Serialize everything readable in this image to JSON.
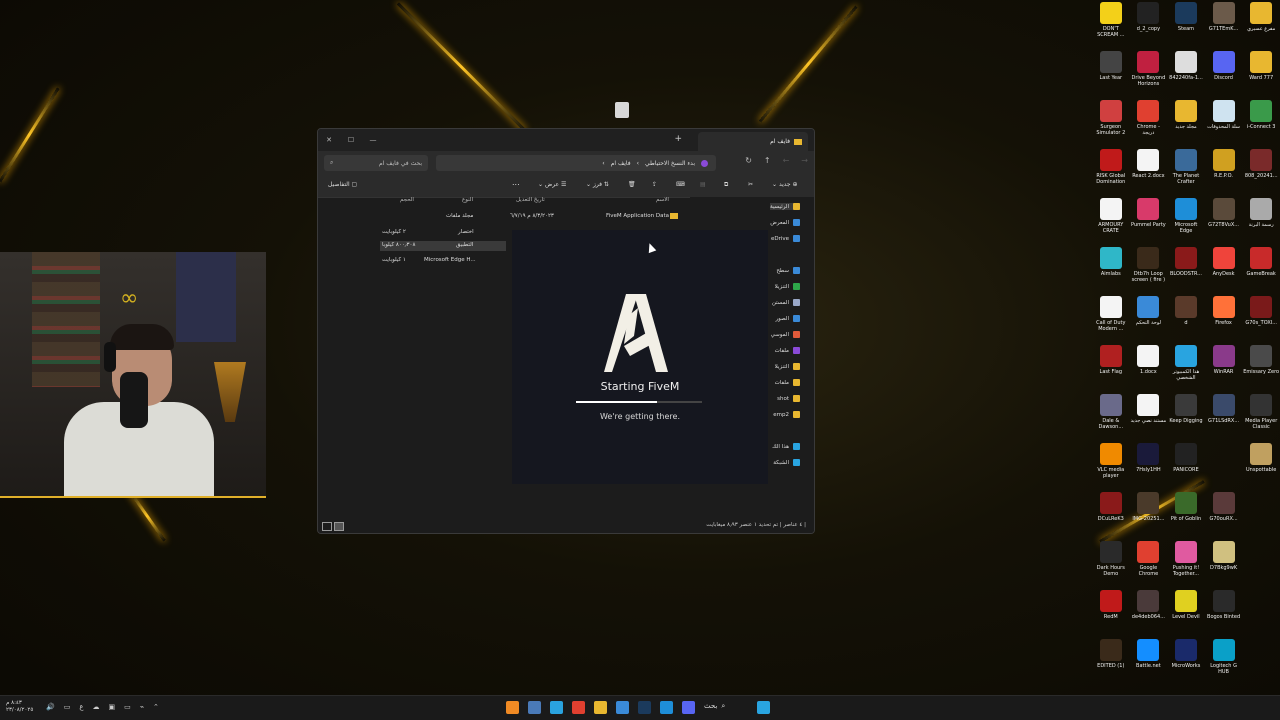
{
  "desktop_icons": [
    {
      "label": "DON'T SCREAM ...",
      "icon": "dont-scream-icon",
      "color": "#f3d019"
    },
    {
      "label": "d_2_copy",
      "icon": "file-icon",
      "color": "#222222"
    },
    {
      "label": "Steam",
      "icon": "steam-icon",
      "color": "#1b3a5c"
    },
    {
      "label": "G71TEmK...",
      "icon": "image-icon",
      "color": "#6b5a4a"
    },
    {
      "label": "مفرغ عسيري",
      "icon": "folder-icon",
      "color": "#e8b730"
    },
    {
      "label": "Last Year",
      "icon": "last-year-icon",
      "color": "#444444"
    },
    {
      "label": "Drive Beyond Horizons",
      "icon": "game-icon",
      "color": "#c02040"
    },
    {
      "label": "842240fa-1...",
      "icon": "qr-icon",
      "color": "#dddddd"
    },
    {
      "label": "Discord",
      "icon": "discord-icon",
      "color": "#5865f2"
    },
    {
      "label": "Ward 777",
      "icon": "folder-icon",
      "color": "#e8b730"
    },
    {
      "label": "Surgeon Simulator 2",
      "icon": "game-icon",
      "color": "#d04040"
    },
    {
      "label": "Chrome - دريجة",
      "icon": "chrome-icon",
      "color": "#e04030"
    },
    {
      "label": "مجلد جديد",
      "icon": "folder-icon",
      "color": "#e8b730"
    },
    {
      "label": "سلة المحذوفات",
      "icon": "recycle-bin-icon",
      "color": "#cfe3f0"
    },
    {
      "label": "i-Connect 3",
      "icon": "app-icon",
      "color": "#3a9a4a"
    },
    {
      "label": "RISK Global Domination",
      "icon": "risk-icon",
      "color": "#c01a1a"
    },
    {
      "label": "React 2.docx",
      "icon": "document-icon",
      "color": "#f4f4f4"
    },
    {
      "label": "The Planet Crafter",
      "icon": "game-icon",
      "color": "#3a6a9a"
    },
    {
      "label": "R.E.P.O.",
      "icon": "game-icon",
      "color": "#d0a020"
    },
    {
      "label": "808_20241...",
      "icon": "image-icon",
      "color": "#7a2a2a"
    },
    {
      "label": "ARMOURY CRATE",
      "icon": "document-icon",
      "color": "#f4f4f4"
    },
    {
      "label": "Pummel Party",
      "icon": "game-icon",
      "color": "#d83a6a"
    },
    {
      "label": "Microsoft Edge",
      "icon": "edge-icon",
      "color": "#1e8ed8"
    },
    {
      "label": "G72T8VuX...",
      "icon": "image-icon",
      "color": "#5a4a3a"
    },
    {
      "label": "رسمة البرنة",
      "icon": "image-icon",
      "color": "#aaaaaa"
    },
    {
      "label": "Aimlabs",
      "icon": "aimlabs-icon",
      "color": "#2fb7c8"
    },
    {
      "label": "Dtb7h Loop screen ( fire )",
      "icon": "video-icon",
      "color": "#3a2a1a"
    },
    {
      "label": "BLOODSTR...",
      "icon": "game-icon",
      "color": "#8a1a1a"
    },
    {
      "label": "AnyDesk",
      "icon": "anydesk-icon",
      "color": "#ef443b"
    },
    {
      "label": "GameBreak",
      "icon": "game-icon",
      "color": "#c82a2a"
    },
    {
      "label": "Call of Duty Modern ...",
      "icon": "document-icon",
      "color": "#f4f4f4"
    },
    {
      "label": "لوحة التحكم",
      "icon": "control-panel-icon",
      "color": "#3a8ad8"
    },
    {
      "label": "d",
      "icon": "file-icon",
      "color": "#5a3a2a"
    },
    {
      "label": "Firefox",
      "icon": "firefox-icon",
      "color": "#ff7139"
    },
    {
      "label": "G70s_TOXI...",
      "icon": "image-icon",
      "color": "#7a1a1a"
    },
    {
      "label": "Last Flag",
      "icon": "game-icon",
      "color": "#b02020"
    },
    {
      "label": "1.docx",
      "icon": "document-icon",
      "color": "#f4f4f4"
    },
    {
      "label": "هذا الكمبيوتر الشخصي",
      "icon": "computer-icon",
      "color": "#29a4e0"
    },
    {
      "label": "WinRAR",
      "icon": "winrar-icon",
      "color": "#8a3a8a"
    },
    {
      "label": "Emissary Zero",
      "icon": "game-icon",
      "color": "#4a4a4a"
    },
    {
      "label": "Dale & Dawson...",
      "icon": "game-icon",
      "color": "#6a6a8a"
    },
    {
      "label": "مستند نصي جديد",
      "icon": "document-icon",
      "color": "#f4f4f4"
    },
    {
      "label": "Keep Digging",
      "icon": "game-icon",
      "color": "#3a3a3a"
    },
    {
      "label": "G71LSdRX...",
      "icon": "image-icon",
      "color": "#3a4a6a"
    },
    {
      "label": "Media Player Classic",
      "icon": "media-player-icon",
      "color": "#333333"
    },
    {
      "label": "VLC media player",
      "icon": "vlc-icon",
      "color": "#f08a00"
    },
    {
      "label": "7Hsly1HH",
      "icon": "image-icon",
      "color": "#1a1a3a"
    },
    {
      "label": "PANICORE",
      "icon": "game-icon",
      "color": "#222222"
    },
    {
      "label": "",
      "icon": "blank-icon",
      "color": "#000000"
    },
    {
      "label": "Unspottable",
      "icon": "game-icon",
      "color": "#c0a060"
    },
    {
      "label": "DCuLReK3",
      "icon": "image-icon",
      "color": "#8a1a1a"
    },
    {
      "label": "IMG-20251...",
      "icon": "image-icon",
      "color": "#4a3a2a"
    },
    {
      "label": "Pit of Goblin",
      "icon": "game-icon",
      "color": "#3a6a2a"
    },
    {
      "label": "G70ouRX...",
      "icon": "image-icon",
      "color": "#5a3a3a"
    },
    {
      "label": "",
      "icon": "blank-icon",
      "color": "#000000"
    },
    {
      "label": "Dark Hours Demo",
      "icon": "game-icon",
      "color": "#2a2a2a"
    },
    {
      "label": "Google Chrome",
      "icon": "chrome-icon",
      "color": "#e04030"
    },
    {
      "label": "Pushing it! Together...",
      "icon": "game-icon",
      "color": "#e05aa0"
    },
    {
      "label": "D7Bkg9wK",
      "icon": "image-icon",
      "color": "#d0c080"
    },
    {
      "label": "",
      "icon": "blank-icon",
      "color": "#000000"
    },
    {
      "label": "RedM",
      "icon": "redm-icon",
      "color": "#c01a1a"
    },
    {
      "label": "de4deb064...",
      "icon": "image-icon",
      "color": "#4a3a3a"
    },
    {
      "label": "Level Devil",
      "icon": "game-icon",
      "color": "#e0d020"
    },
    {
      "label": "Bogos Binted",
      "icon": "game-icon",
      "color": "#2a2a2a"
    },
    {
      "label": "",
      "icon": "blank-icon",
      "color": "#000000"
    },
    {
      "label": "EDITED (1)",
      "icon": "image-icon",
      "color": "#3a2a1a"
    },
    {
      "label": "Battle.net",
      "icon": "battlenet-icon",
      "color": "#148eff"
    },
    {
      "label": "MicroWorks",
      "icon": "microworks-icon",
      "color": "#1a2a6a"
    },
    {
      "label": "Logitech G HUB",
      "icon": "logitech-icon",
      "color": "#0aa0c8"
    }
  ],
  "explorer": {
    "tab_title": "فايف ام",
    "search_placeholder": "بحث في فايف ام",
    "breadcrumb": [
      "بدء النسخ الاحتياطي",
      "فايف ام"
    ],
    "toolbar": {
      "new": "جديد",
      "sort": "فرز",
      "view": "عرض",
      "more": "...",
      "details": "التفاصيل"
    },
    "columns": {
      "name": "الاسم",
      "date": "تاريخ التعديل",
      "type": "النوع",
      "size": "الحجم"
    },
    "rows": [
      {
        "name": "FiveM Application Data",
        "date": "٨/٣/٢٠٢٣ م ٦/٧/١٩",
        "type": "مجلد ملفات",
        "size": ""
      },
      {
        "name": "",
        "date": "",
        "type": "اختصار",
        "size": "٢ كيلوبايت"
      },
      {
        "name": "",
        "date": "",
        "type": "التطبيق",
        "size": "٨٠٠٫٣٠٨ كيلوبا"
      },
      {
        "name": "",
        "date": "",
        "type": "Microsoft Edge H...",
        "size": "١ كيلوبايت"
      }
    ],
    "nav": [
      {
        "label": "الرئيسية",
        "color": "#e8b730"
      },
      {
        "label": "المعرض",
        "color": "#3a8ad8"
      },
      {
        "label": "eDrive",
        "color": "#3a8ad8"
      },
      {
        "label": "سطح",
        "color": "#3a8ad8"
      },
      {
        "label": "التنزيلا",
        "color": "#2ea84a"
      },
      {
        "label": "المستن",
        "color": "#9aa8c8"
      },
      {
        "label": "الصور",
        "color": "#3a8ad8"
      },
      {
        "label": "الموسي",
        "color": "#e05a3a"
      },
      {
        "label": "ملفات",
        "color": "#8a4ad8"
      },
      {
        "label": "التنزيلا",
        "color": "#e8b730"
      },
      {
        "label": "ملفات",
        "color": "#e8b730"
      },
      {
        "label": "shot",
        "color": "#e8b730"
      },
      {
        "label": "emp2",
        "color": "#e8b730"
      },
      {
        "label": "هذا الك",
        "color": "#29a4e0"
      },
      {
        "label": "الشبكة",
        "color": "#29a4e0"
      }
    ],
    "status": "٤ عناصر  |  تم تحديد ١ عنصر ٨٫٩٣ ميغابايت  |"
  },
  "splash": {
    "title": "Starting FiveM",
    "subtitle": "We're getting there.",
    "progress": 0.64
  },
  "taskbar": {
    "clock_time": "٨:٤٣ م",
    "clock_date": "٢٣/٠٨/٢٠٢٥",
    "lang": "ع",
    "search_label": "بحث",
    "apps": [
      {
        "icon": "fivem-icon",
        "color": "#f08a24"
      },
      {
        "icon": "taskview-icon",
        "color": "#4a7ab8"
      },
      {
        "icon": "telegram-icon",
        "color": "#2aa3df"
      },
      {
        "icon": "chrome-icon",
        "color": "#e04030"
      },
      {
        "icon": "file-explorer-icon",
        "color": "#e8b730"
      },
      {
        "icon": "store-icon",
        "color": "#3a8ad8"
      },
      {
        "icon": "steam-icon",
        "color": "#1b3a5c"
      },
      {
        "icon": "edge-icon",
        "color": "#1e8ed8"
      },
      {
        "icon": "discord-icon",
        "color": "#5865f2"
      },
      {
        "icon": "start-icon",
        "color": "#29a4e0"
      }
    ]
  }
}
